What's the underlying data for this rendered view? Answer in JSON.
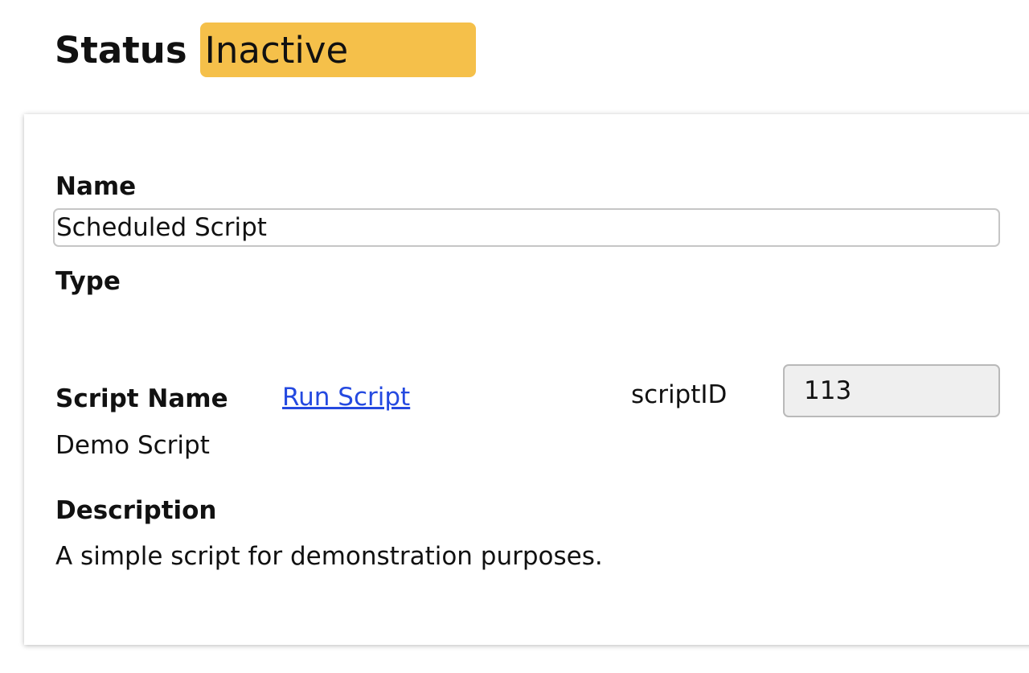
{
  "status": {
    "label": "Status",
    "value": "Inactive",
    "badge_color": "#f5c04a"
  },
  "form": {
    "name_label": "Name",
    "name_value": "Scheduled Script",
    "type_label": "Type",
    "script_name_label": "Script Name",
    "run_script_link": "Run Script",
    "script_name_value": "Demo Script",
    "script_id_label": "scriptID",
    "script_id_value": "113",
    "description_label": "Description",
    "description_value": "A simple script for demonstration purposes."
  },
  "colors": {
    "link": "#2449e0",
    "readonly_field_bg": "#efefef"
  }
}
